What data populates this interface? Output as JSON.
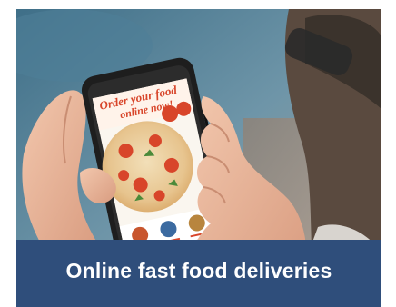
{
  "photo": {
    "subject": "hands holding smartphone",
    "screen": {
      "headline_line1": "Order your food",
      "headline_line2": "online now!"
    }
  },
  "caption": {
    "text": "Online fast food deliveries"
  },
  "colors": {
    "caption_bar": "#2f4e7b",
    "caption_text": "#ffffff",
    "sea": "#4c7a92",
    "screen_red": "#d8452a"
  }
}
